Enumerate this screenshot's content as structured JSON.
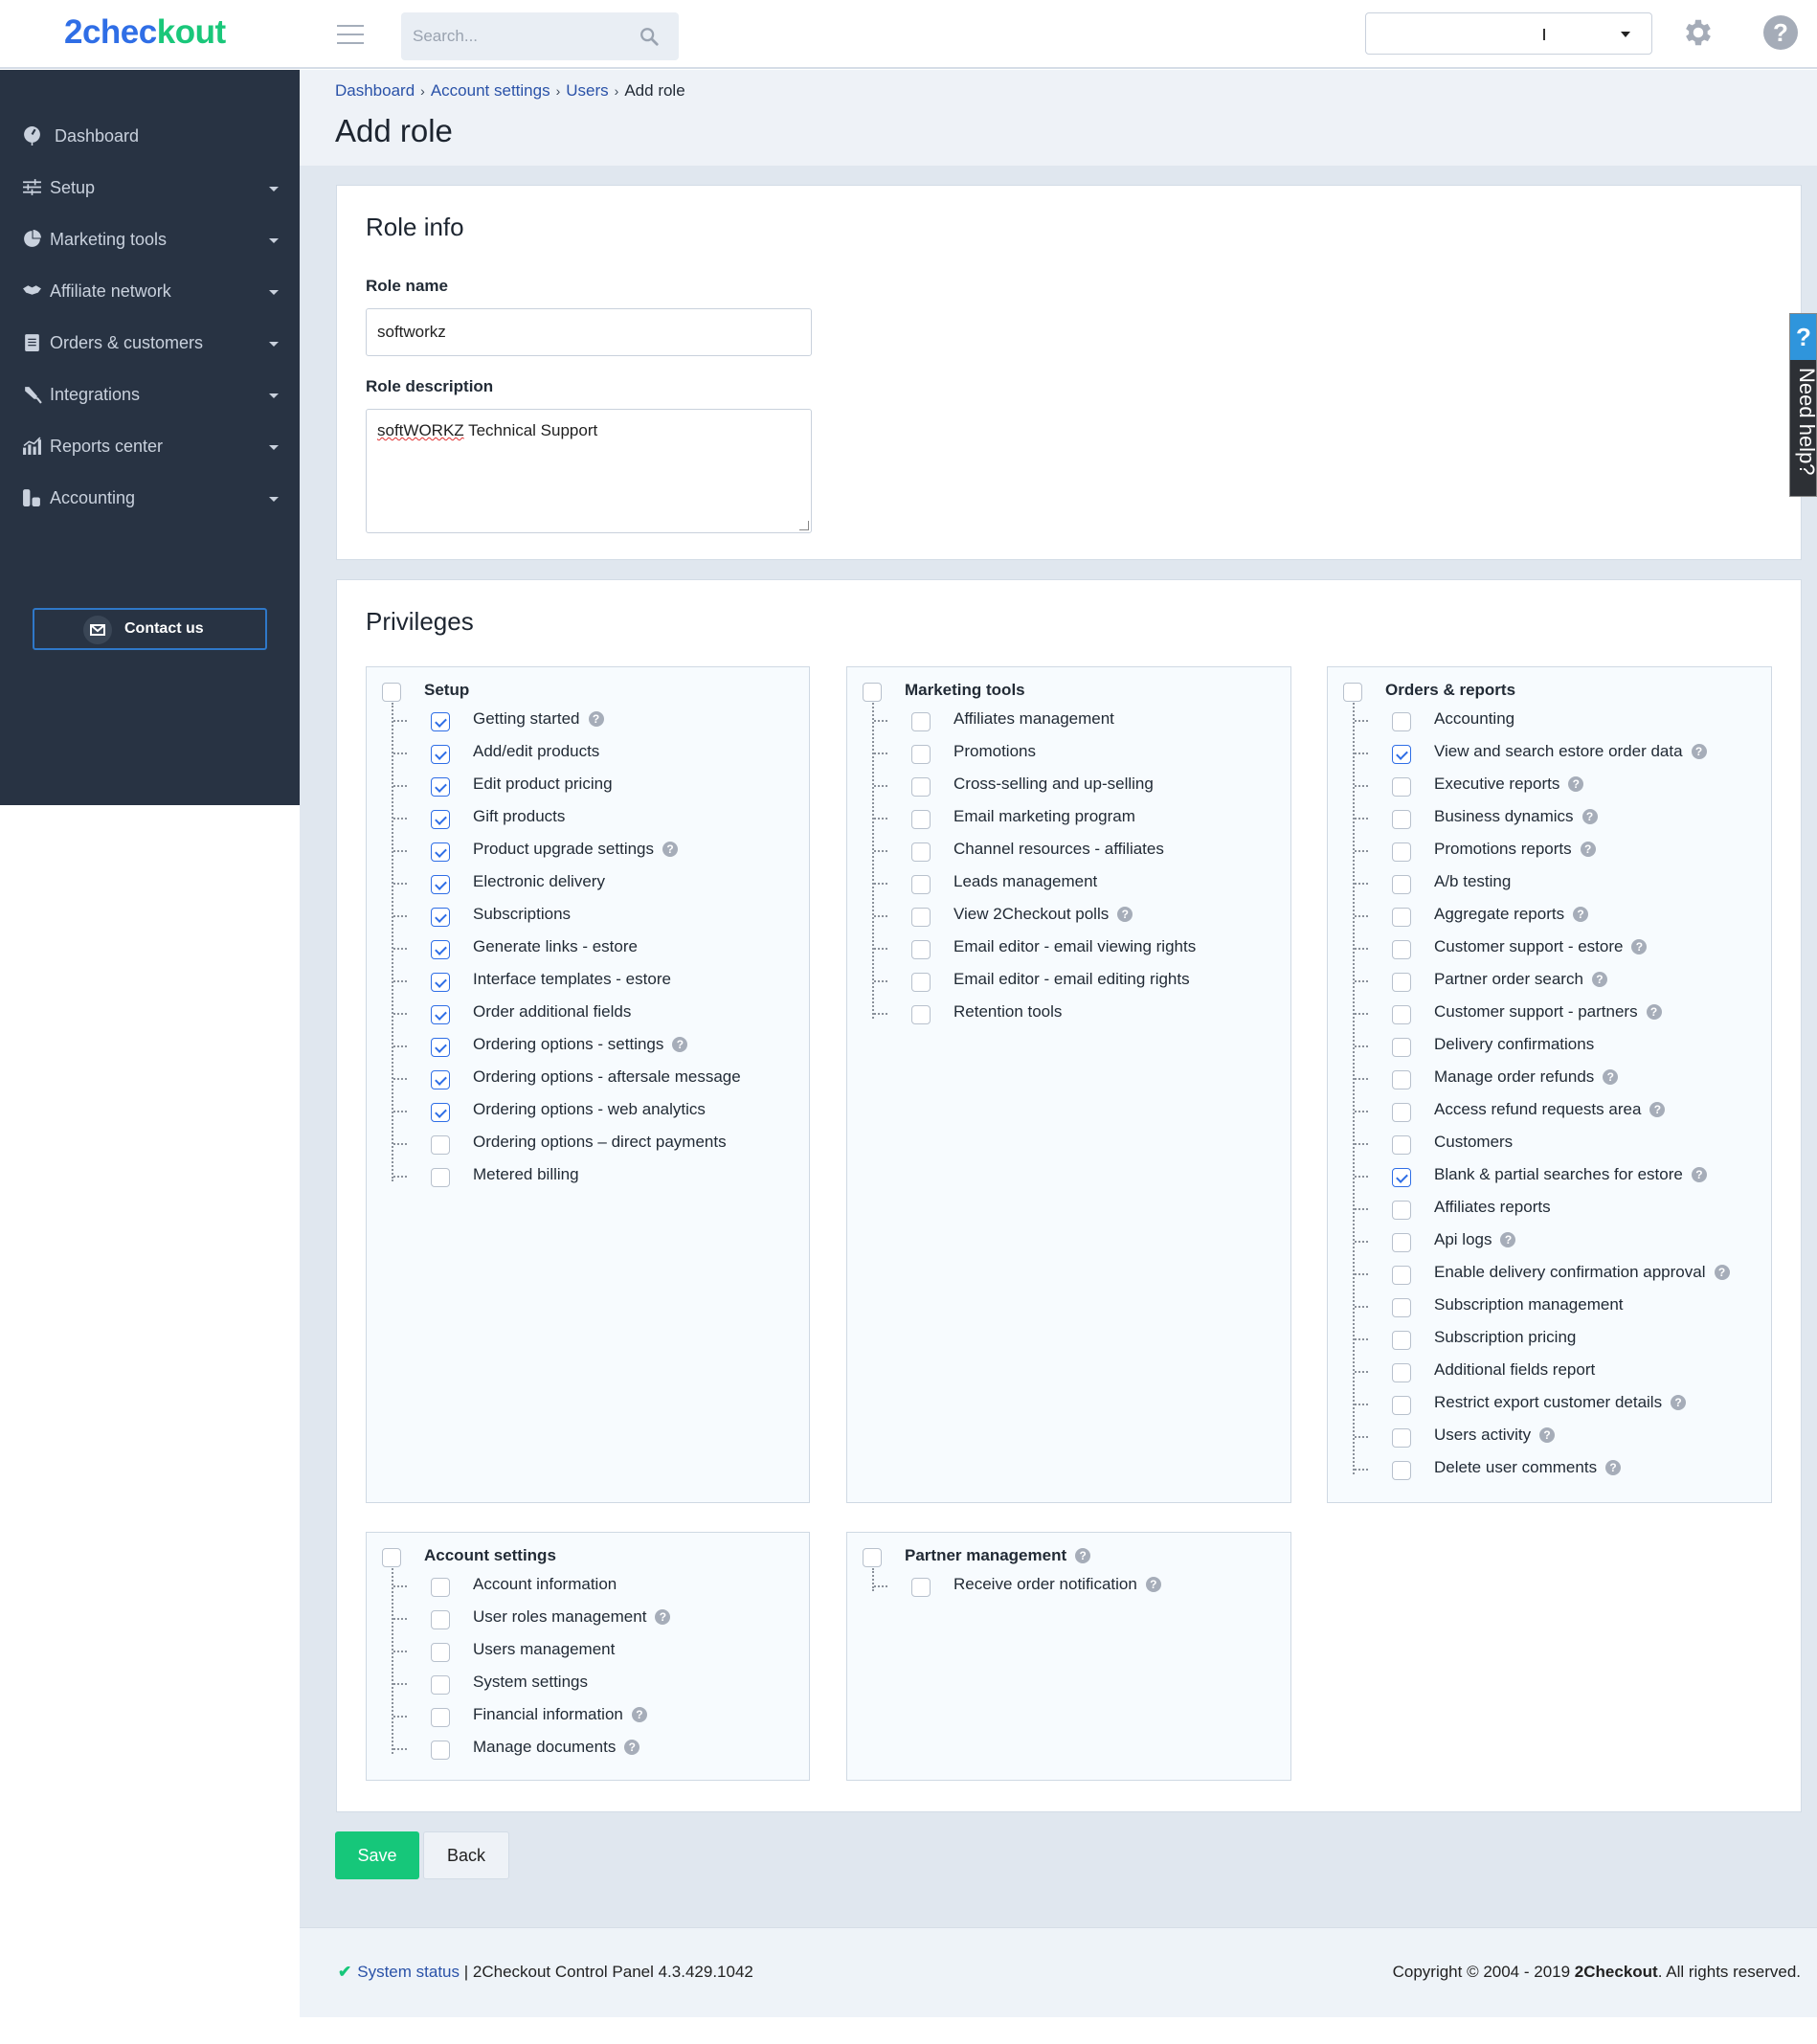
{
  "header": {
    "logo_part1": "2chec",
    "logo_part2": "kout",
    "search_placeholder": "Search...",
    "account_selector_value": ""
  },
  "sidebar": {
    "items": [
      {
        "label": "Dashboard",
        "icon": "dashboard-gauge-icon",
        "has_submenu": false
      },
      {
        "label": "Setup",
        "icon": "sliders-icon",
        "has_submenu": true
      },
      {
        "label": "Marketing tools",
        "icon": "pie-chart-icon",
        "has_submenu": true
      },
      {
        "label": "Affiliate network",
        "icon": "handshake-icon",
        "has_submenu": true
      },
      {
        "label": "Orders & customers",
        "icon": "clipboard-icon",
        "has_submenu": true
      },
      {
        "label": "Integrations",
        "icon": "plug-icon",
        "has_submenu": true
      },
      {
        "label": "Reports center",
        "icon": "bar-chart-icon",
        "has_submenu": true
      },
      {
        "label": "Accounting",
        "icon": "coins-icon",
        "has_submenu": true
      }
    ],
    "contact_label": "Contact us"
  },
  "breadcrumb": [
    "Dashboard",
    "Account settings",
    "Users",
    "Add role"
  ],
  "page_title": "Add role",
  "role_info": {
    "title": "Role info",
    "name_label": "Role name",
    "name_value": "softworkz",
    "description_label": "Role description",
    "description_value_misspelled": "softWORKZ",
    "description_value_rest": " Technical Support"
  },
  "privileges": {
    "title": "Privileges",
    "groups": [
      {
        "title": "Setup",
        "checked": false,
        "help": false,
        "items": [
          {
            "label": "Getting started",
            "checked": true,
            "help": true
          },
          {
            "label": "Add/edit products",
            "checked": true,
            "help": false
          },
          {
            "label": "Edit product pricing",
            "checked": true,
            "help": false
          },
          {
            "label": "Gift products",
            "checked": true,
            "help": false
          },
          {
            "label": "Product upgrade settings",
            "checked": true,
            "help": true
          },
          {
            "label": "Electronic delivery",
            "checked": true,
            "help": false
          },
          {
            "label": "Subscriptions",
            "checked": true,
            "help": false
          },
          {
            "label": "Generate links - estore",
            "checked": true,
            "help": false
          },
          {
            "label": "Interface templates - estore",
            "checked": true,
            "help": false
          },
          {
            "label": "Order additional fields",
            "checked": true,
            "help": false
          },
          {
            "label": "Ordering options - settings",
            "checked": true,
            "help": true
          },
          {
            "label": "Ordering options - aftersale message",
            "checked": true,
            "help": false
          },
          {
            "label": "Ordering options - web analytics",
            "checked": true,
            "help": false
          },
          {
            "label": "Ordering options – direct payments",
            "checked": false,
            "help": false
          },
          {
            "label": "Metered billing",
            "checked": false,
            "help": false
          }
        ]
      },
      {
        "title": "Marketing tools",
        "checked": false,
        "help": false,
        "items": [
          {
            "label": "Affiliates management",
            "checked": false,
            "help": false
          },
          {
            "label": "Promotions",
            "checked": false,
            "help": false
          },
          {
            "label": "Cross-selling and up-selling",
            "checked": false,
            "help": false
          },
          {
            "label": "Email marketing program",
            "checked": false,
            "help": false
          },
          {
            "label": "Channel resources - affiliates",
            "checked": false,
            "help": false
          },
          {
            "label": "Leads management",
            "checked": false,
            "help": false
          },
          {
            "label": "View 2Checkout polls",
            "checked": false,
            "help": true
          },
          {
            "label": "Email editor - email viewing rights",
            "checked": false,
            "help": false
          },
          {
            "label": "Email editor - email editing rights",
            "checked": false,
            "help": false
          },
          {
            "label": "Retention tools",
            "checked": false,
            "help": false
          }
        ]
      },
      {
        "title": "Orders & reports",
        "checked": false,
        "help": false,
        "items": [
          {
            "label": "Accounting",
            "checked": false,
            "help": false
          },
          {
            "label": "View and search estore order data",
            "checked": true,
            "help": true
          },
          {
            "label": "Executive reports",
            "checked": false,
            "help": true
          },
          {
            "label": "Business dynamics",
            "checked": false,
            "help": true
          },
          {
            "label": "Promotions reports",
            "checked": false,
            "help": true
          },
          {
            "label": "A/b testing",
            "checked": false,
            "help": false
          },
          {
            "label": "Aggregate reports",
            "checked": false,
            "help": true
          },
          {
            "label": "Customer support - estore",
            "checked": false,
            "help": true
          },
          {
            "label": "Partner order search",
            "checked": false,
            "help": true
          },
          {
            "label": "Customer support - partners",
            "checked": false,
            "help": true
          },
          {
            "label": "Delivery confirmations",
            "checked": false,
            "help": false
          },
          {
            "label": "Manage order refunds",
            "checked": false,
            "help": true
          },
          {
            "label": "Access refund requests area",
            "checked": false,
            "help": true
          },
          {
            "label": "Customers",
            "checked": false,
            "help": false
          },
          {
            "label": "Blank & partial searches for estore",
            "checked": true,
            "help": true
          },
          {
            "label": "Affiliates reports",
            "checked": false,
            "help": false
          },
          {
            "label": "Api logs",
            "checked": false,
            "help": true
          },
          {
            "label": "Enable delivery confirmation approval",
            "checked": false,
            "help": true
          },
          {
            "label": "Subscription management",
            "checked": false,
            "help": false
          },
          {
            "label": "Subscription pricing",
            "checked": false,
            "help": false
          },
          {
            "label": "Additional fields report",
            "checked": false,
            "help": false
          },
          {
            "label": "Restrict export customer details",
            "checked": false,
            "help": true
          },
          {
            "label": "Users activity",
            "checked": false,
            "help": true
          },
          {
            "label": "Delete user comments",
            "checked": false,
            "help": true
          }
        ]
      },
      {
        "title": "Account settings",
        "checked": false,
        "help": false,
        "items": [
          {
            "label": "Account information",
            "checked": false,
            "help": false
          },
          {
            "label": "User roles management",
            "checked": false,
            "help": true
          },
          {
            "label": "Users management",
            "checked": false,
            "help": false
          },
          {
            "label": "System settings",
            "checked": false,
            "help": false
          },
          {
            "label": "Financial information",
            "checked": false,
            "help": true
          },
          {
            "label": "Manage documents",
            "checked": false,
            "help": true
          }
        ]
      },
      {
        "title": "Partner management",
        "checked": false,
        "help": true,
        "items": [
          {
            "label": "Receive order notification",
            "checked": false,
            "help": true
          }
        ]
      }
    ]
  },
  "actions": {
    "save_label": "Save",
    "back_label": "Back"
  },
  "footer": {
    "status_link": "System status",
    "version_text": " | 2Checkout Control Panel 4.3.429.1042",
    "copyright_prefix": "Copyright © 2004 - 2019 ",
    "copyright_brand": "2Checkout",
    "copyright_suffix": ". All rights reserved."
  },
  "need_help": {
    "icon_text": "?",
    "label": "Need help?"
  },
  "help_icon_text": "?"
}
